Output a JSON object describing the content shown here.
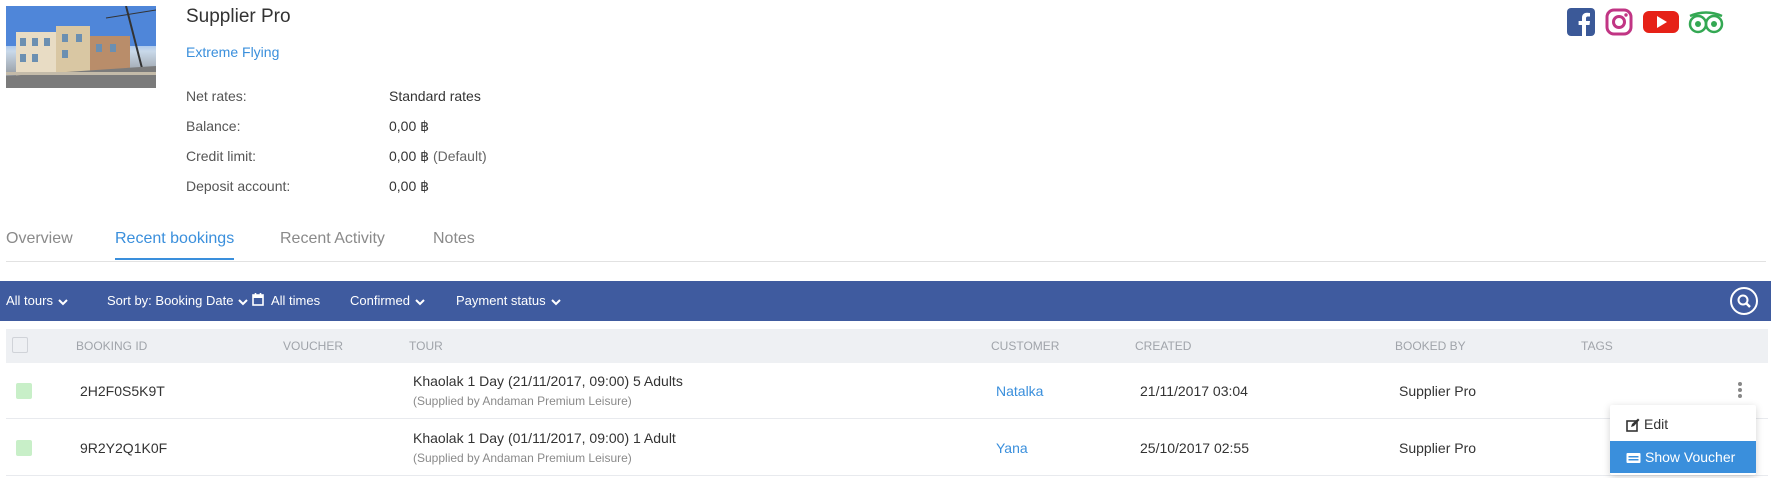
{
  "profile": {
    "name": "Supplier Pro",
    "company_link": "Extreme Flying",
    "fields": [
      {
        "label": "Net rates:",
        "value": "Standard rates",
        "note": ""
      },
      {
        "label": "Balance:",
        "value": "0,00 ฿",
        "note": ""
      },
      {
        "label": "Credit limit:",
        "value": "0,00 ฿",
        "note": "(Default)"
      },
      {
        "label": "Deposit account:",
        "value": "0,00 ฿",
        "note": ""
      }
    ]
  },
  "social": [
    "facebook-icon",
    "instagram-icon",
    "youtube-icon",
    "tripadvisor-icon"
  ],
  "tabs": [
    {
      "label": "Overview",
      "active": false
    },
    {
      "label": "Recent bookings",
      "active": true
    },
    {
      "label": "Recent Activity",
      "active": false
    },
    {
      "label": "Notes",
      "active": false
    }
  ],
  "filters": {
    "tours": "All tours",
    "sort": "Sort by: Booking Date",
    "times": "All times",
    "status": "Confirmed",
    "payment": "Payment status"
  },
  "table": {
    "headers": [
      "BOOKING ID",
      "VOUCHER",
      "TOUR",
      "CUSTOMER",
      "CREATED",
      "BOOKED BY",
      "TAGS"
    ],
    "rows": [
      {
        "booking_id": "2H2F0S5K9T",
        "voucher": "",
        "tour": "Khaolak 1 Day (21/11/2017, 09:00) 5 Adults",
        "supplied": "(Supplied by Andaman Premium Leisure)",
        "customer": "Natalka",
        "created": "21/11/2017 03:04",
        "booked_by": "Supplier Pro"
      },
      {
        "booking_id": "9R2Y2Q1K0F",
        "voucher": "",
        "tour": "Khaolak 1 Day (01/11/2017, 09:00) 1 Adult",
        "supplied": "(Supplied by Andaman Premium Leisure)",
        "customer": "Yana",
        "created": "25/10/2017 02:55",
        "booked_by": "Supplier Pro"
      }
    ]
  },
  "context_menu": {
    "edit": "Edit",
    "show_voucher": "Show Voucher"
  },
  "colors": {
    "accent": "#3a8fdc",
    "filter_bar": "#3f5b9f",
    "status_confirmed": "#c8efc8",
    "facebook": "#3b5998",
    "instagram": "#c13584",
    "youtube": "#e62117",
    "tripadvisor": "#34a853"
  }
}
